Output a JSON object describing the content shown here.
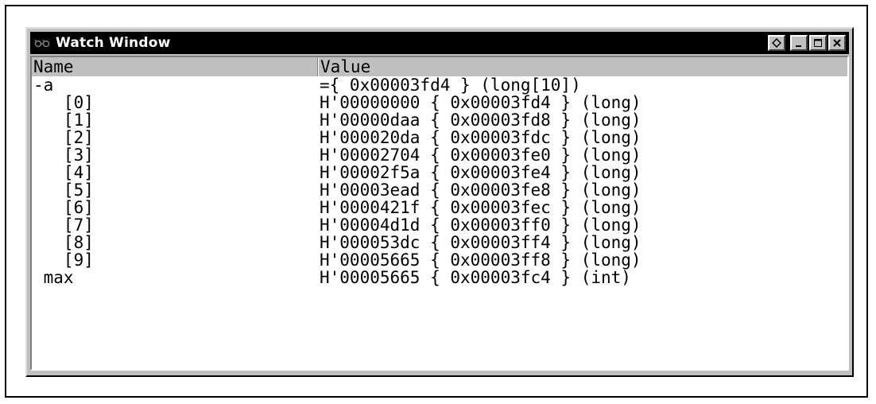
{
  "window": {
    "title": "Watch Window",
    "icon": "watch-glasses-icon",
    "buttons": [
      "pin-icon",
      "minimize-icon",
      "maximize-icon",
      "close-icon"
    ]
  },
  "columns": {
    "name": "Name",
    "value": "Value"
  },
  "rows": [
    {
      "name": "-a",
      "value": "={ 0x00003fd4 } (long[10])"
    },
    {
      "name": "   [0]",
      "value": "H'00000000 { 0x00003fd4 } (long)"
    },
    {
      "name": "   [1]",
      "value": "H'00000daa { 0x00003fd8 } (long)"
    },
    {
      "name": "   [2]",
      "value": "H'000020da { 0x00003fdc } (long)"
    },
    {
      "name": "   [3]",
      "value": "H'00002704 { 0x00003fe0 } (long)"
    },
    {
      "name": "   [4]",
      "value": "H'00002f5a { 0x00003fe4 } (long)"
    },
    {
      "name": "   [5]",
      "value": "H'00003ead { 0x00003fe8 } (long)"
    },
    {
      "name": "   [6]",
      "value": "H'0000421f { 0x00003fec } (long)"
    },
    {
      "name": "   [7]",
      "value": "H'00004d1d { 0x00003ff0 } (long)"
    },
    {
      "name": "   [8]",
      "value": "H'000053dc { 0x00003ff4 } (long)"
    },
    {
      "name": "   [9]",
      "value": "H'00005665 { 0x00003ff8 } (long)"
    },
    {
      "name": " max",
      "value": "H'00005665 { 0x00003fc4 } (int)"
    }
  ]
}
